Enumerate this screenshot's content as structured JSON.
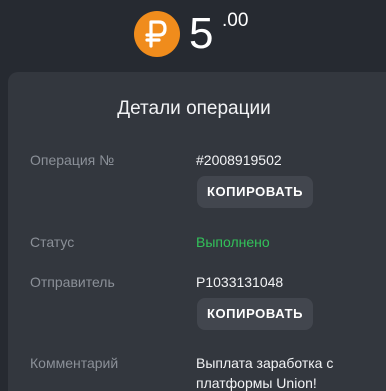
{
  "balance": {
    "currency_icon": "ruble-coin-icon",
    "amount_integer": "5",
    "amount_decimal": ".00",
    "coin_color": "#f08c1c"
  },
  "details": {
    "title": "Детали операции",
    "operation_label": "Операция №",
    "operation_value": "#2008919502",
    "copy_label_1": "КОПИРОВАТЬ",
    "status_label": "Статус",
    "status_value": "Выполнено",
    "status_color": "#33c25a",
    "sender_label": "Отправитель",
    "sender_value": "P1033131048",
    "copy_label_2": "КОПИРОВАТЬ",
    "comment_label": "Комментарий",
    "comment_value": "Выплата заработка с платформы Union!"
  }
}
